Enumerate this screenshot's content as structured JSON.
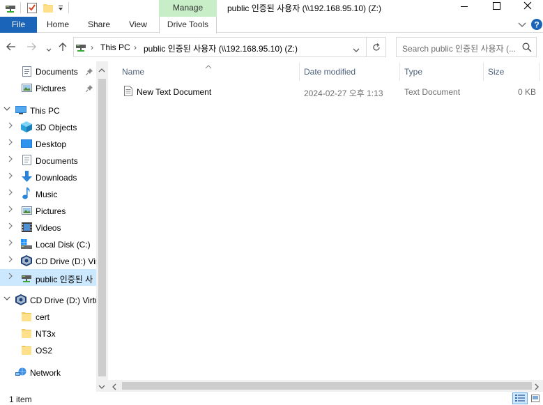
{
  "window": {
    "title": "public 인증된 사용자 (\\\\192.168.95.10) (Z:)",
    "manage_tab": "Manage"
  },
  "ribbon": {
    "file": "File",
    "home": "Home",
    "share": "Share",
    "view": "View",
    "drive_tools": "Drive Tools"
  },
  "address": {
    "crumb_root": "This PC",
    "crumb_current": "public 인증된 사용자 (\\\\192.168.95.10) (Z:)",
    "search_placeholder": "Search public 인증된 사용자 (..."
  },
  "nav": {
    "quick_documents": "Documents",
    "quick_pictures": "Pictures",
    "this_pc": "This PC",
    "objects3d": "3D Objects",
    "desktop": "Desktop",
    "documents": "Documents",
    "downloads": "Downloads",
    "music": "Music",
    "pictures": "Pictures",
    "videos": "Videos",
    "local_disk": "Local Disk (C:)",
    "cd_drive_sub": "CD Drive (D:) Vir",
    "public_drive": "public 인증된 사",
    "cd_drive_root": "CD Drive (D:) Virtu",
    "cert": "cert",
    "nt3x": "NT3x",
    "os2": "OS2",
    "network": "Network"
  },
  "columns": {
    "name": "Name",
    "date": "Date modified",
    "type": "Type",
    "size": "Size"
  },
  "files": [
    {
      "name": "New Text Document",
      "date": "2024-02-27 오후 1:13",
      "type": "Text Document",
      "size": "0 KB"
    }
  ],
  "status": {
    "count": "1 item"
  },
  "colors": {
    "accent": "#1a64b9",
    "manage_tab": "#c7eec6",
    "selection": "#cce8ff"
  }
}
